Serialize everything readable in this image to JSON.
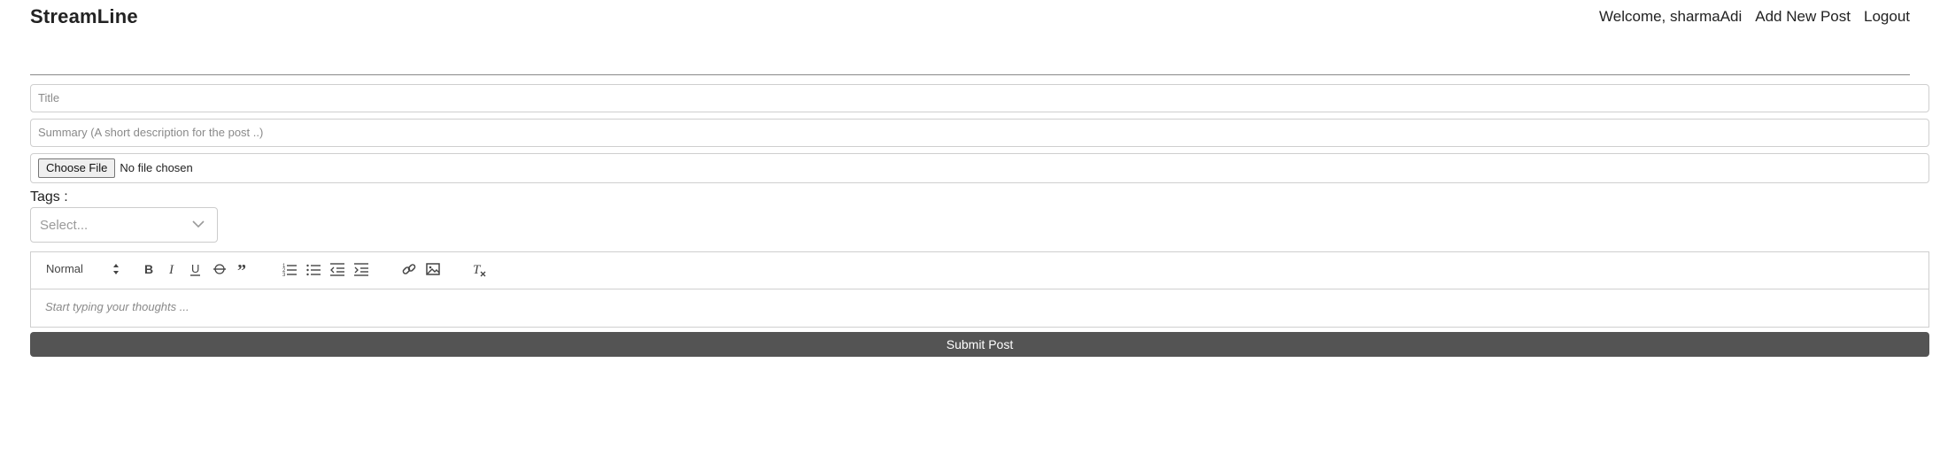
{
  "header": {
    "brand": "StreamLine",
    "welcome": "Welcome, sharmaAdi",
    "add_post_link": "Add New Post",
    "logout_link": "Logout"
  },
  "form": {
    "title_placeholder": "Title",
    "summary_placeholder": "Summary (A short description for the post ..)",
    "file_button": "Choose File",
    "file_status": "No file chosen",
    "tags_label": "Tags :",
    "tags_placeholder": "Select...",
    "editor": {
      "format_value": "Normal",
      "toolbar_icons": [
        "bold-icon",
        "italic-icon",
        "underline-icon",
        "strikethrough-icon",
        "blockquote-icon",
        "ordered-list-icon",
        "bullet-list-icon",
        "outdent-icon",
        "indent-icon",
        "link-icon",
        "image-icon",
        "clear-format-icon"
      ],
      "placeholder": "Start typing your thoughts ..."
    },
    "submit_label": "Submit Post"
  },
  "colors": {
    "submit_bg": "#545454",
    "border": "#cfcfcf",
    "placeholder": "#8a8a8a"
  }
}
